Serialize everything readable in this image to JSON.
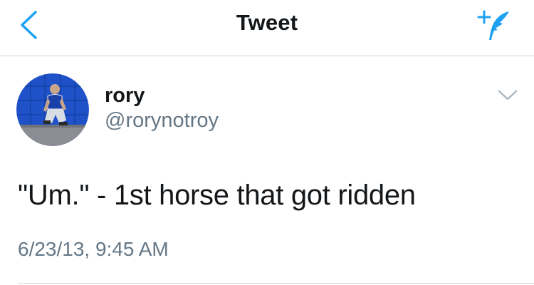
{
  "nav": {
    "title": "Tweet",
    "back_icon": "chevron-left-icon",
    "compose_icon": "compose-tweet-icon"
  },
  "tweet": {
    "author_name": "rory",
    "author_handle": "@rorynotroy",
    "text": "\"Um.\" - 1st horse that got ridden",
    "timestamp": "6/23/13, 9:45 AM",
    "menu_icon": "chevron-down-icon"
  },
  "colors": {
    "accent": "#1da1f2",
    "primary_text": "#14171a",
    "secondary_text": "#657786",
    "divider": "#cfd6dc"
  }
}
